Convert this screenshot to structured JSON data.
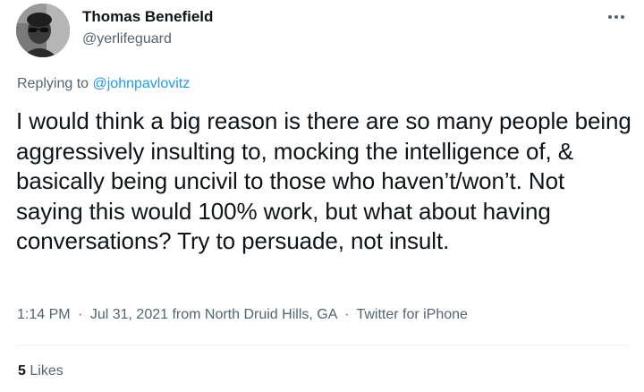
{
  "author": {
    "display_name": "Thomas Benefield",
    "handle": "@yerlifeguard",
    "avatar_icon": "user-avatar-photo"
  },
  "more_icon": "more-horizontal-icon",
  "reply": {
    "prefix": "Replying to",
    "target": "@johnpavlovitz"
  },
  "tweet": {
    "text": "I would think a big reason is there are so many people being aggressively insulting to, mocking the intelligence of, & basically being uncivil to those who haven’t/won’t. Not saying this would 100% work, but what about having conversations? Try to persuade, not insult."
  },
  "meta": {
    "time": "1:14 PM",
    "separator": "·",
    "date": "Jul 31, 2021 from North Druid Hills, GA",
    "source": "Twitter for iPhone"
  },
  "stats": {
    "likes_count": "5",
    "likes_label": "Likes"
  },
  "colors": {
    "link": "#1d9bf0",
    "secondary_text": "#536471",
    "primary_text": "#0f1419",
    "divider": "#eff3f4"
  }
}
